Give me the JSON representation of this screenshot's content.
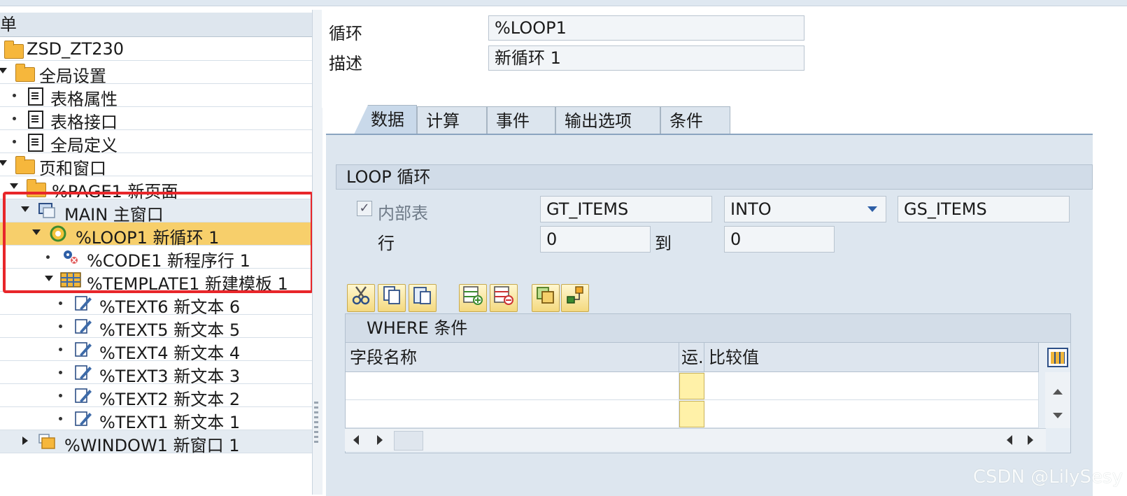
{
  "tree": {
    "header": "单",
    "items": [
      {
        "label": "ZSD_ZT230",
        "icon": "folder-open-icon"
      },
      {
        "label": "全局设置",
        "icon": "folder-open-icon"
      },
      {
        "label": "表格属性",
        "icon": "document-icon"
      },
      {
        "label": "表格接口",
        "icon": "document-icon"
      },
      {
        "label": "全局定义",
        "icon": "document-icon"
      },
      {
        "label": "页和窗口",
        "icon": "folder-open-icon"
      },
      {
        "label": "%PAGE1 新页面",
        "icon": "folder-open-icon"
      },
      {
        "label": "MAIN 主窗口",
        "icon": "window-icon"
      },
      {
        "label": "%LOOP1 新循环 1",
        "icon": "loop-icon"
      },
      {
        "label": "%CODE1 新程序行 1",
        "icon": "code-gears-icon"
      },
      {
        "label": "%TEMPLATE1 新建模板 1",
        "icon": "template-grid-icon"
      },
      {
        "label": "%TEXT6 新文本 6",
        "icon": "text-pencil-icon"
      },
      {
        "label": "%TEXT5 新文本 5",
        "icon": "text-pencil-icon"
      },
      {
        "label": "%TEXT4 新文本 4",
        "icon": "text-pencil-icon"
      },
      {
        "label": "%TEXT3 新文本 3",
        "icon": "text-pencil-icon"
      },
      {
        "label": "%TEXT2 新文本 2",
        "icon": "text-pencil-icon"
      },
      {
        "label": "%TEXT1 新文本 1",
        "icon": "text-pencil-icon"
      },
      {
        "label": "%WINDOW1 新窗口 1",
        "icon": "window-folder-icon"
      }
    ]
  },
  "header": {
    "loop_label": "循环",
    "loop_value": "%LOOP1",
    "desc_label": "描述",
    "desc_value": "新循环 1"
  },
  "tabs": [
    {
      "label": "数据",
      "active": true
    },
    {
      "label": "计算"
    },
    {
      "label": "事件"
    },
    {
      "label": "输出选项"
    },
    {
      "label": "条件"
    }
  ],
  "loop_group": {
    "title": "LOOP 循环",
    "internal_table_label": "内部表",
    "internal_table_checked": true,
    "internal_table_value": "GT_ITEMS",
    "into_value": "INTO",
    "work_area_value": "GS_ITEMS",
    "row_label": "行",
    "row_from": "0",
    "to_label": "到",
    "row_to": "0"
  },
  "toolbar": {
    "cut": "cut-icon",
    "copy": "copy-icon",
    "paste": "paste-icon",
    "insert_row": "insert-row-icon",
    "delete_row": "delete-row-icon",
    "copy_rows": "copy-rows-icon",
    "hierarchy": "hierarchy-icon"
  },
  "where": {
    "title": "WHERE 条件",
    "col_field": "字段名称",
    "col_op": "运.",
    "col_value": "比较值"
  },
  "watermark": "CSDN @LilySesy",
  "colors": {
    "selected_row": "#f7cf6b",
    "highlight_box": "#e8262a",
    "panel_bg": "#dde6ef"
  }
}
